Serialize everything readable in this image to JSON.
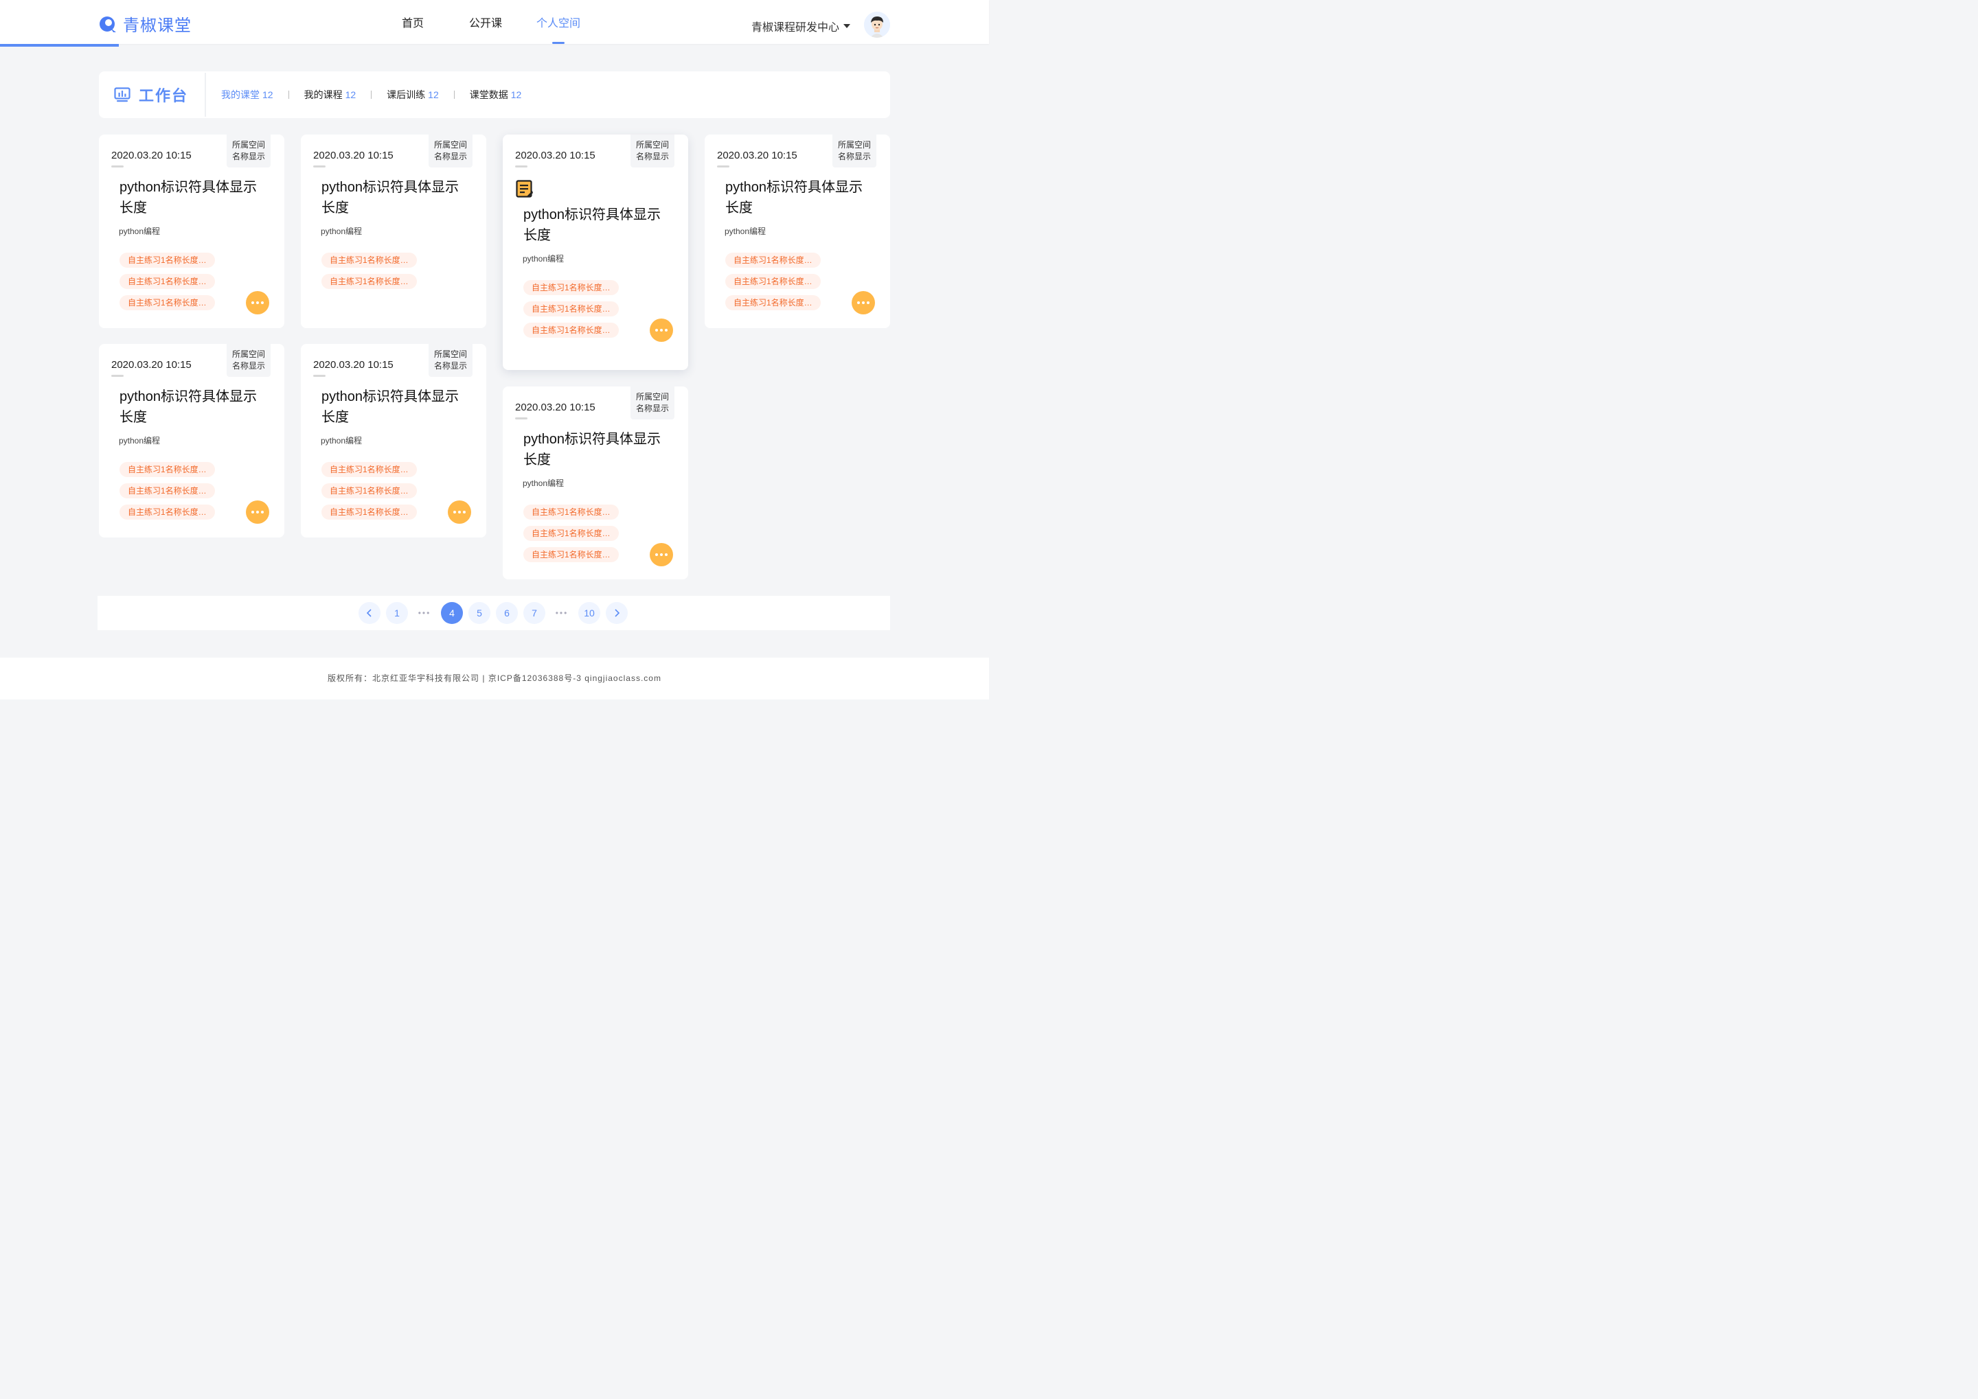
{
  "brand": {
    "name": "青椒课堂",
    "accent": "#5b8cf6",
    "more_button_color": "#ffb848",
    "tag_text_color": "#f26a2b"
  },
  "nav": {
    "items": [
      {
        "label": "首页",
        "active": false
      },
      {
        "label": "公开课",
        "active": false
      },
      {
        "label": "个人空间",
        "active": true
      }
    ]
  },
  "user": {
    "org_name": "青椒课程研发中心",
    "avatar": "avatar-icon"
  },
  "workbench": {
    "title": "工作台",
    "icon": "chart-board-icon",
    "tabs": [
      {
        "label": "我的课堂",
        "count": "12",
        "active": true
      },
      {
        "label": "我的课程",
        "count": "12",
        "active": false
      },
      {
        "label": "课后训练",
        "count": "12",
        "active": false
      },
      {
        "label": "课堂数据",
        "count": "12",
        "active": false
      }
    ]
  },
  "cards": [
    {
      "date": "2020.03.20 10:15",
      "space": "所属空间\n名称显示",
      "title": "python标识符具体显示长度",
      "subject": "python编程",
      "tags": [
        "自主练习1名称长度…",
        "自主练习1名称长度…",
        "自主练习1名称长度…"
      ],
      "has_more_button": true,
      "has_doc_icon": false,
      "elevated": false
    },
    {
      "date": "2020.03.20 10:15",
      "space": "所属空间\n名称显示",
      "title": "python标识符具体显示长度",
      "subject": "python编程",
      "tags": [
        "自主练习1名称长度…",
        "自主练习1名称长度…"
      ],
      "has_more_button": false,
      "has_doc_icon": false,
      "elevated": false
    },
    {
      "date": "2020.03.20 10:15",
      "space": "所属空间\n名称显示",
      "title": "python标识符具体显示长度",
      "subject": "python编程",
      "tags": [
        "自主练习1名称长度…",
        "自主练习1名称长度…",
        "自主练习1名称长度…"
      ],
      "has_more_button": true,
      "has_doc_icon": true,
      "elevated": true
    },
    {
      "date": "2020.03.20 10:15",
      "space": "所属空间\n名称显示",
      "title": "python标识符具体显示长度",
      "subject": "python编程",
      "tags": [
        "自主练习1名称长度…",
        "自主练习1名称长度…",
        "自主练习1名称长度…"
      ],
      "has_more_button": true,
      "has_doc_icon": false,
      "elevated": false
    },
    {
      "date": "2020.03.20 10:15",
      "space": "所属空间\n名称显示",
      "title": "python标识符具体显示长度",
      "subject": "python编程",
      "tags": [
        "自主练习1名称长度…",
        "自主练习1名称长度…",
        "自主练习1名称长度…"
      ],
      "has_more_button": true,
      "has_doc_icon": false,
      "elevated": false
    },
    {
      "date": "2020.03.20 10:15",
      "space": "所属空间\n名称显示",
      "title": "python标识符具体显示长度",
      "subject": "python编程",
      "tags": [
        "自主练习1名称长度…",
        "自主练习1名称长度…",
        "自主练习1名称长度…"
      ],
      "has_more_button": true,
      "has_doc_icon": false,
      "elevated": false
    },
    {
      "date": "2020.03.20 10:15",
      "space": "所属空间\n名称显示",
      "title": "python标识符具体显示长度",
      "subject": "python编程",
      "tags": [
        "自主练习1名称长度…",
        "自主练习1名称长度…",
        "自主练习1名称长度…"
      ],
      "has_more_button": true,
      "has_doc_icon": false,
      "elevated": false
    }
  ],
  "pagination": {
    "prev_icon": "chevron-left-icon",
    "next_icon": "chevron-right-icon",
    "items": [
      {
        "label": "1",
        "type": "page"
      },
      {
        "label": "•••",
        "type": "ellipsis"
      },
      {
        "label": "4",
        "type": "page",
        "active": true
      },
      {
        "label": "5",
        "type": "page"
      },
      {
        "label": "6",
        "type": "page"
      },
      {
        "label": "7",
        "type": "page"
      },
      {
        "label": "•••",
        "type": "ellipsis"
      },
      {
        "label": "10",
        "type": "page"
      }
    ]
  },
  "footer": {
    "text": "版权所有：北京红亚华宇科技有限公司 | 京ICP备12036388号-3 qingjiaoclass.com"
  }
}
